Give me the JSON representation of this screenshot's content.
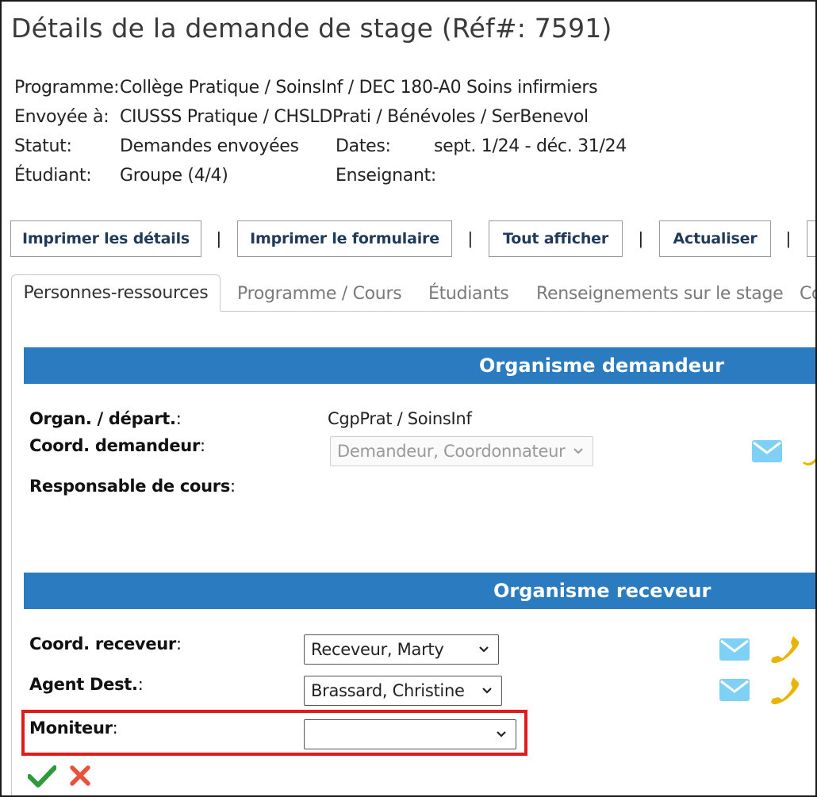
{
  "title": "Détails de la demande de stage (Réf#: 7591)",
  "info": {
    "programme_label": "Programme:",
    "programme_value": "Collège Pratique / SoinsInf / DEC 180-A0 Soins infirmiers",
    "envoyee_label": "Envoyée à:",
    "envoyee_value": "CIUSSS Pratique / CHSLDPrati / Bénévoles / SerBenevol",
    "statut_label": "Statut:",
    "statut_value": "Demandes envoyées",
    "dates_label": "Dates:",
    "dates_value": "sept. 1/24 - déc. 31/24",
    "etudiant_label": "Étudiant:",
    "etudiant_value": "Groupe (4/4)",
    "enseignant_label": "Enseignant:"
  },
  "toolbar": {
    "print_details": "Imprimer les détails",
    "print_form": "Imprimer le formulaire",
    "show_all": "Tout afficher",
    "refresh": "Actualiser",
    "separator": "|"
  },
  "tabs": [
    "Personnes-ressources",
    "Programme / Cours",
    "Étudiants",
    "Renseignements sur le stage",
    "Co"
  ],
  "demandeur": {
    "header": "Organisme demandeur",
    "organ_label": "Organ. / départ.",
    "organ_value": "CgpPrat / SoinsInf",
    "coord_label": "Coord. demandeur",
    "coord_value": "Demandeur, Coordonnateur",
    "resp_label": "Responsable de cours"
  },
  "receveur": {
    "header": "Organisme receveur",
    "coord_label": "Coord. receveur",
    "coord_value": "Receveur, Marty",
    "agent_label": "Agent Dest.",
    "agent_value": "Brassard, Christine",
    "moniteur_label": "Moniteur",
    "moniteur_value": ""
  },
  "colon": ":",
  "icons": {
    "mail": "mail-icon",
    "phone": "phone-icon",
    "confirm": "checkmark-icon",
    "cancel": "close-icon"
  },
  "colors": {
    "band": "#2a7bbf",
    "mail": "#7fd0f5",
    "phone": "#e8b400",
    "confirm": "#2e9a3c",
    "cancel": "#e8523a",
    "highlight": "#e11a1a"
  }
}
